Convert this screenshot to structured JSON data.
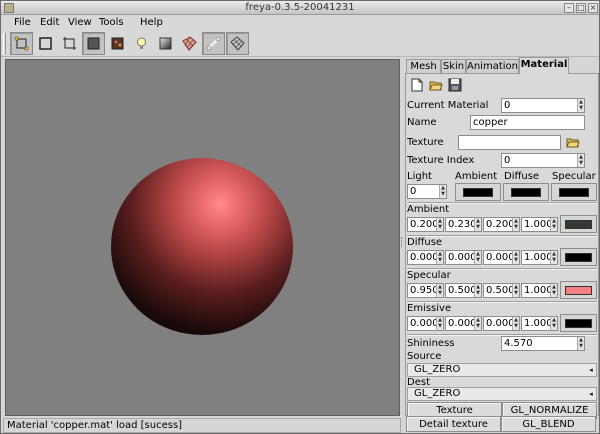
{
  "window": {
    "title": "freya-0.3.5-20041231"
  },
  "menu": [
    "File",
    "Edit",
    "View",
    "Tools",
    "Help"
  ],
  "toolbar": {
    "buttons": [
      {
        "icon": "select-mode-icon",
        "pressed": true
      },
      {
        "icon": "frame-mode-icon",
        "pressed": false
      },
      {
        "icon": "transform-mode-icon",
        "pressed": false
      },
      {
        "icon": "solid-shading-icon",
        "pressed": true
      },
      {
        "icon": "texture-icon",
        "pressed": false
      },
      {
        "icon": "light-bulb-icon",
        "pressed": false
      },
      {
        "icon": "gradient-icon",
        "pressed": false
      },
      {
        "icon": "textured-mesh-icon",
        "pressed": false
      },
      {
        "icon": "bone-icon",
        "pressed": true
      },
      {
        "icon": "grid-icon",
        "pressed": true
      }
    ]
  },
  "panel": {
    "tabs": [
      "Mesh",
      "Skin",
      "Animation",
      "Material"
    ],
    "active_tab": "Material",
    "current_material_label": "Current Material",
    "current_material_value": "0",
    "name_label": "Name",
    "name_value": "copper",
    "texture_label": "Texture",
    "texture_value": "",
    "texture_index_label": "Texture Index",
    "texture_index_value": "0",
    "light_label": "Light",
    "light_value": "0",
    "ambient_col_label": "Ambient",
    "diffuse_col_label": "Diffuse",
    "specular_col_label": "Specular",
    "ambient_label": "Ambient",
    "ambient_values": [
      "0.200",
      "0.230",
      "0.200",
      "1.000"
    ],
    "diffuse_label": "Diffuse",
    "diffuse_values": [
      "0.000",
      "0.000",
      "0.000",
      "1.000"
    ],
    "specular_label": "Specular",
    "specular_values": [
      "0.950",
      "0.500",
      "0.500",
      "1.000"
    ],
    "emissive_label": "Emissive",
    "emissive_values": [
      "0.000",
      "0.000",
      "0.000",
      "1.000"
    ],
    "shininess_label": "Shininess",
    "shininess_value": "4.570",
    "source_label": "Source",
    "source_value": "GL_ZERO",
    "dest_label": "Dest",
    "dest_value": "GL_ZERO",
    "btn_texture": "Texture",
    "btn_gl_normalize": "GL_NORMALIZE",
    "btn_detail_texture": "Detail texture",
    "btn_gl_blend": "GL_BLEND"
  },
  "colors": {
    "light_ambient": "#000000",
    "light_diffuse": "#000000",
    "light_specular": "#000000",
    "ambient": "#333a33",
    "diffuse": "#000000",
    "specular": "#f28080",
    "emissive": "#000000",
    "viewport_bg": "#808080"
  },
  "status": "Material 'copper.mat' load [sucess]"
}
